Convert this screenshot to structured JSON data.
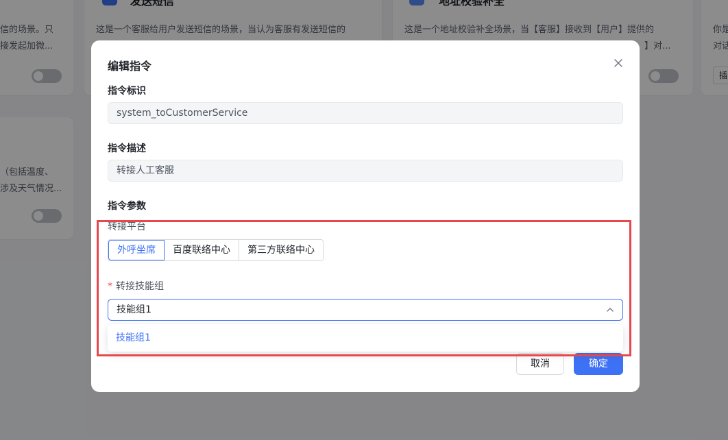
{
  "background": {
    "card_left_top_text1": "信的场景。只",
    "card_left_top_text2": "接发起加微...",
    "card_middle_title": "发送短信",
    "card_middle_text": "这是一个客服给用户发送短信的场景，当认为客服有发送短信的",
    "card_right_title": "地址校验补全",
    "card_right_text1": "这是一个地址校验补全场景，当【客服】接收到【用户】提供的",
    "card_right_text2": "】对...",
    "card_far_right_text1": "你是",
    "card_far_right_text2": "对话",
    "card_far_right_btn": "插",
    "card_left_bottom_text1": "（包括温度、",
    "card_left_bottom_text2": "涉及天气情况..."
  },
  "modal": {
    "title": "编辑指令",
    "field_id_label": "指令标识",
    "field_id_value": "system_toCustomerService",
    "field_desc_label": "指令描述",
    "field_desc_value": "转接人工客服",
    "params_label": "指令参数",
    "platform_label": "转接平台",
    "platform_options": [
      "外呼坐席",
      "百度联络中心",
      "第三方联络中心"
    ],
    "platform_selected": "外呼坐席",
    "skill_group_label": "转接技能组",
    "skill_group_required": "*",
    "skill_group_value": "技能组1",
    "dropdown_options": [
      "技能组1"
    ],
    "cancel_label": "取消",
    "confirm_label": "确定"
  },
  "colors": {
    "accent": "#3d72f5",
    "highlight": "#e8474c",
    "required": "#f04848"
  }
}
